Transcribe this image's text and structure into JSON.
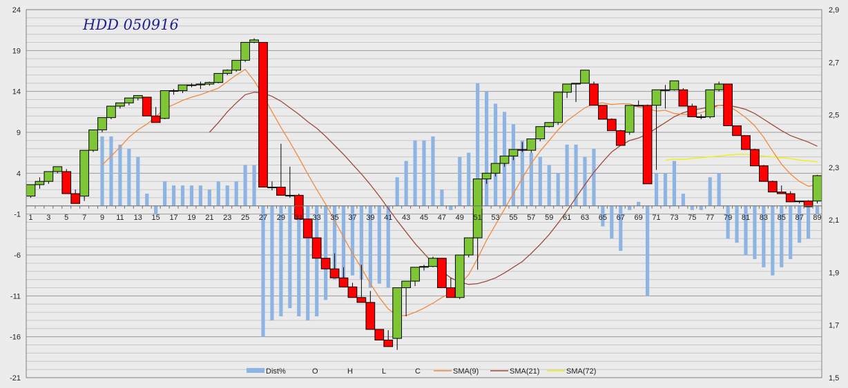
{
  "chart_data": {
    "type": "candlestick",
    "title": "HDD 050916",
    "y_left": {
      "min": -21,
      "max": 24,
      "ticks": [
        "24",
        "19",
        "14",
        "9",
        "4",
        "-1",
        "-6",
        "-11",
        "-16",
        "-21"
      ]
    },
    "y_right": {
      "min": 1.5,
      "max": 2.9,
      "ticks": [
        "2,9",
        "2,7",
        "2,5",
        "2,3",
        "2,1",
        "1,9",
        "1,7",
        "1,5"
      ]
    },
    "x_tick_labels": [
      "1",
      "3",
      "5",
      "7",
      "9",
      "11",
      "13",
      "15",
      "17",
      "19",
      "21",
      "23",
      "25",
      "27",
      "29",
      "31",
      "33",
      "35",
      "37",
      "39",
      "41",
      "43",
      "45",
      "47",
      "49",
      "51",
      "53",
      "55",
      "57",
      "59",
      "61",
      "63",
      "65",
      "67",
      "69",
      "71",
      "73",
      "75",
      "77",
      "79",
      "81",
      "83",
      "85",
      "87",
      "89"
    ],
    "legend": [
      "Dist%",
      "O",
      "H",
      "L",
      "C",
      "SMA(9)",
      "SMA(21)",
      "SMA(72)"
    ],
    "colors": {
      "dist": "#8eb4e3",
      "up_candle": "#7ec636",
      "down_candle": "#ff0000",
      "sma9": "#f08a3e",
      "sma21": "#9e4a3c",
      "sma72": "#f0f000"
    },
    "dist": [
      0,
      0,
      0,
      0,
      0,
      0,
      0,
      0,
      8.5,
      8.5,
      7.5,
      7,
      6,
      1.5,
      -1,
      3,
      2.5,
      2.5,
      2.5,
      2.5,
      2,
      3,
      2.5,
      3,
      5,
      5,
      -16,
      -14,
      -13.5,
      -12.5,
      -13.5,
      -14,
      -13.5,
      -11.5,
      -9,
      -9,
      -8.5,
      -9,
      -10,
      -9.5,
      -10,
      3.5,
      5.5,
      8,
      8,
      8.5,
      2,
      -0.5,
      6,
      6.5,
      15,
      14,
      12.5,
      11.5,
      10,
      8,
      6.5,
      6,
      5,
      4,
      7.5,
      7.5,
      6,
      7,
      -2.5,
      -4,
      -5.5,
      -0.5,
      0.5,
      -11,
      4,
      4,
      5.5,
      1.5,
      -0.5,
      -0.5,
      3.5,
      4,
      -4,
      -4.5,
      -6,
      -6.5,
      -7.5,
      -8.5,
      -7.5,
      -6.5,
      -4.5,
      -4,
      -1
    ],
    "ohlc": [
      [
        1.2,
        2.6,
        1.0,
        2.6
      ],
      [
        2.6,
        3.5,
        2.1,
        3.0
      ],
      [
        3.0,
        4.0,
        2.7,
        4.2
      ],
      [
        4.2,
        4.8,
        4.0,
        4.8
      ],
      [
        4.2,
        4.5,
        1.5,
        1.5
      ],
      [
        1.5,
        2.0,
        0.3,
        0.3
      ],
      [
        1.2,
        6.8,
        0.6,
        6.8
      ],
      [
        6.8,
        9.3,
        6.6,
        9.3
      ],
      [
        9.3,
        10.8,
        9.0,
        10.8
      ],
      [
        10.8,
        12.2,
        10.6,
        12.2
      ],
      [
        12.2,
        12.6,
        11.9,
        12.6
      ],
      [
        12.6,
        13.2,
        12.3,
        13.2
      ],
      [
        13.2,
        13.5,
        12.9,
        13.5
      ],
      [
        13.3,
        13.3,
        11.0,
        11.0
      ],
      [
        11.0,
        12.1,
        10.2,
        10.2
      ],
      [
        10.7,
        14.1,
        10.6,
        14.1
      ],
      [
        14.1,
        14.3,
        13.6,
        14.1
      ],
      [
        14.1,
        14.8,
        13.8,
        14.8
      ],
      [
        14.8,
        15.0,
        14.5,
        14.8
      ],
      [
        14.8,
        15.2,
        14.3,
        14.9
      ],
      [
        14.9,
        15.2,
        14.7,
        15.1
      ],
      [
        15.1,
        16.2,
        15.0,
        16.2
      ],
      [
        16.2,
        16.7,
        16.0,
        16.6
      ],
      [
        16.6,
        17.8,
        16.4,
        17.8
      ],
      [
        17.8,
        20.0,
        17.6,
        20.0
      ],
      [
        20.0,
        20.5,
        19.9,
        20.3
      ],
      [
        20.0,
        20.0,
        2.3,
        2.3
      ],
      [
        2.3,
        3.0,
        1.9,
        2.3
      ],
      [
        2.3,
        7.6,
        1.9,
        1.3
      ],
      [
        1.3,
        4.8,
        1.0,
        1.3
      ],
      [
        1.3,
        1.5,
        -1.6,
        -1.6
      ],
      [
        -1.6,
        -1.6,
        -3.9,
        -3.9
      ],
      [
        -3.9,
        -4.1,
        -6.4,
        -6.4
      ],
      [
        -6.4,
        -6.6,
        -7.7,
        -7.7
      ],
      [
        -7.7,
        -5.8,
        -8.8,
        -8.8
      ],
      [
        -8.8,
        -7.5,
        -9.9,
        -9.9
      ],
      [
        -9.9,
        -9.4,
        -11.2,
        -11.2
      ],
      [
        -11.2,
        -7.2,
        -11.8,
        -11.8
      ],
      [
        -11.8,
        -10.4,
        -15.1,
        -15.1
      ],
      [
        -15.1,
        -16.4,
        -16.4,
        -16.4
      ],
      [
        -16.4,
        -15.2,
        -17.2,
        -17.2
      ],
      [
        -16.2,
        -15.4,
        -17.6,
        -10.0
      ],
      [
        -10.0,
        -9.8,
        -13.5,
        -9.2
      ],
      [
        -9.2,
        -9.0,
        -9.8,
        -7.5
      ],
      [
        -7.5,
        -7.2,
        -7.9,
        -7.4
      ],
      [
        -7.4,
        -6.2,
        -7.5,
        -6.4
      ],
      [
        -6.4,
        -7.5,
        -10.0,
        -10.0
      ],
      [
        -10.0,
        -8.8,
        -11.2,
        -11.2
      ],
      [
        -11.2,
        -10.5,
        -11.4,
        -6.0
      ],
      [
        -6.0,
        -3.9,
        -6.3,
        -3.9
      ],
      [
        -3.9,
        -3.6,
        -7.8,
        3.3
      ],
      [
        3.3,
        4.0,
        2.7,
        4.0
      ],
      [
        4.0,
        5.2,
        3.6,
        5.2
      ],
      [
        5.2,
        6.1,
        4.8,
        6.1
      ],
      [
        6.1,
        6.9,
        5.6,
        6.9
      ],
      [
        6.9,
        7.8,
        6.6,
        6.8
      ],
      [
        6.8,
        8.2,
        6.5,
        8.2
      ],
      [
        8.2,
        9.7,
        7.9,
        9.7
      ],
      [
        9.7,
        10.2,
        9.6,
        10.2
      ],
      [
        10.2,
        13.9,
        9.9,
        13.9
      ],
      [
        13.9,
        14.9,
        13.2,
        14.9
      ],
      [
        14.9,
        15.0,
        12.7,
        15.0
      ],
      [
        15.0,
        16.6,
        15.0,
        16.6
      ],
      [
        14.9,
        15.2,
        12.3,
        12.3
      ],
      [
        12.3,
        12.0,
        10.6,
        10.6
      ],
      [
        10.6,
        10.7,
        9.2,
        9.2
      ],
      [
        9.2,
        9.3,
        7.4,
        7.4
      ],
      [
        9.0,
        12.3,
        8.7,
        12.3
      ],
      [
        12.3,
        12.9,
        12.3,
        12.3
      ],
      [
        12.3,
        12.4,
        2.7,
        2.7
      ],
      [
        12.3,
        14.2,
        4.4,
        14.2
      ],
      [
        14.2,
        14.8,
        11.9,
        14.2
      ],
      [
        14.2,
        15.3,
        14.1,
        15.3
      ],
      [
        14.2,
        14.4,
        12.2,
        12.2
      ],
      [
        12.2,
        12.5,
        10.9,
        10.9
      ],
      [
        10.9,
        11.2,
        10.6,
        10.9
      ],
      [
        10.9,
        14.2,
        10.7,
        14.2
      ],
      [
        14.2,
        15.2,
        14.0,
        14.9
      ],
      [
        14.9,
        14.7,
        9.8,
        9.8
      ],
      [
        9.8,
        9.8,
        8.6,
        8.6
      ],
      [
        8.6,
        8.6,
        6.9,
        6.9
      ],
      [
        6.9,
        7.0,
        4.9,
        4.9
      ],
      [
        4.9,
        5.0,
        3.0,
        3.0
      ],
      [
        3.0,
        3.1,
        1.7,
        1.7
      ],
      [
        1.7,
        2.5,
        1.5,
        1.5
      ],
      [
        1.5,
        1.8,
        0.5,
        0.5
      ],
      [
        0.6,
        0.6,
        0.3,
        0.6
      ],
      [
        0.6,
        0.7,
        -0.1,
        -0.1
      ],
      [
        0.6,
        3.8,
        0.3,
        3.7
      ]
    ],
    "sma9": [
      null,
      null,
      null,
      null,
      null,
      null,
      null,
      null,
      5.0,
      6.1,
      7.2,
      8.4,
      9.3,
      10.0,
      10.9,
      11.9,
      12.4,
      12.9,
      13.3,
      13.6,
      14.0,
      14.4,
      15.2,
      16.0,
      16.7,
      15.3,
      13.5,
      11.5,
      9.6,
      7.8,
      5.9,
      3.9,
      2.0,
      0.2,
      -1.8,
      -3.8,
      -5.8,
      -7.6,
      -9.5,
      -11.2,
      -12.6,
      -13.4,
      -13.4,
      -13.0,
      -12.5,
      -11.9,
      -11.2,
      -10.6,
      -9.6,
      -8.4,
      -6.4,
      -4.2,
      -2.3,
      -0.4,
      1.5,
      3.4,
      5.2,
      6.7,
      8.0,
      9.3,
      10.4,
      11.2,
      12.0,
      12.5,
      12.6,
      12.4,
      12.5,
      12.5,
      12.1,
      11.9,
      11.6,
      11.7,
      11.3,
      11.2,
      11.2,
      11.4,
      11.8,
      12.3,
      12.2,
      11.6,
      10.8,
      9.8,
      8.4,
      6.7,
      5.1,
      3.9,
      3.0,
      2.4,
      2.6
    ],
    "sma21": [
      null,
      null,
      null,
      null,
      null,
      null,
      null,
      null,
      null,
      null,
      null,
      null,
      null,
      null,
      null,
      null,
      null,
      null,
      null,
      null,
      9.0,
      10.2,
      11.5,
      12.6,
      13.6,
      13.9,
      13.8,
      13.4,
      12.8,
      12.0,
      11.2,
      10.3,
      9.5,
      8.5,
      7.4,
      6.3,
      5.1,
      3.9,
      2.6,
      1.2,
      -0.3,
      -1.8,
      -3.2,
      -4.6,
      -5.8,
      -7.0,
      -8.0,
      -8.8,
      -9.3,
      -9.6,
      -9.5,
      -9.2,
      -8.8,
      -8.2,
      -7.5,
      -6.8,
      -5.8,
      -4.7,
      -3.5,
      -2.1,
      -0.6,
      1.0,
      2.6,
      4.1,
      5.4,
      6.6,
      7.4,
      8.0,
      8.3,
      8.8,
      9.5,
      10.2,
      10.9,
      11.4,
      11.7,
      11.9,
      12.1,
      12.3,
      12.3,
      12.1,
      11.8,
      11.3,
      10.6,
      9.9,
      9.2,
      8.6,
      8.2,
      7.8,
      7.3
    ],
    "sma72": [
      null,
      null,
      null,
      null,
      null,
      null,
      null,
      null,
      null,
      null,
      null,
      null,
      null,
      null,
      null,
      null,
      null,
      null,
      null,
      null,
      null,
      null,
      null,
      null,
      null,
      null,
      null,
      null,
      null,
      null,
      null,
      null,
      null,
      null,
      null,
      null,
      null,
      null,
      null,
      null,
      null,
      null,
      null,
      null,
      null,
      null,
      null,
      null,
      null,
      null,
      null,
      null,
      null,
      null,
      null,
      null,
      null,
      null,
      null,
      null,
      null,
      null,
      null,
      null,
      null,
      null,
      null,
      null,
      null,
      null,
      null,
      5.6,
      5.7,
      5.7,
      5.8,
      5.9,
      6.0,
      6.1,
      6.2,
      6.3,
      6.3,
      6.2,
      6.1,
      6.0,
      5.9,
      5.8,
      5.6,
      5.5,
      5.4
    ]
  }
}
